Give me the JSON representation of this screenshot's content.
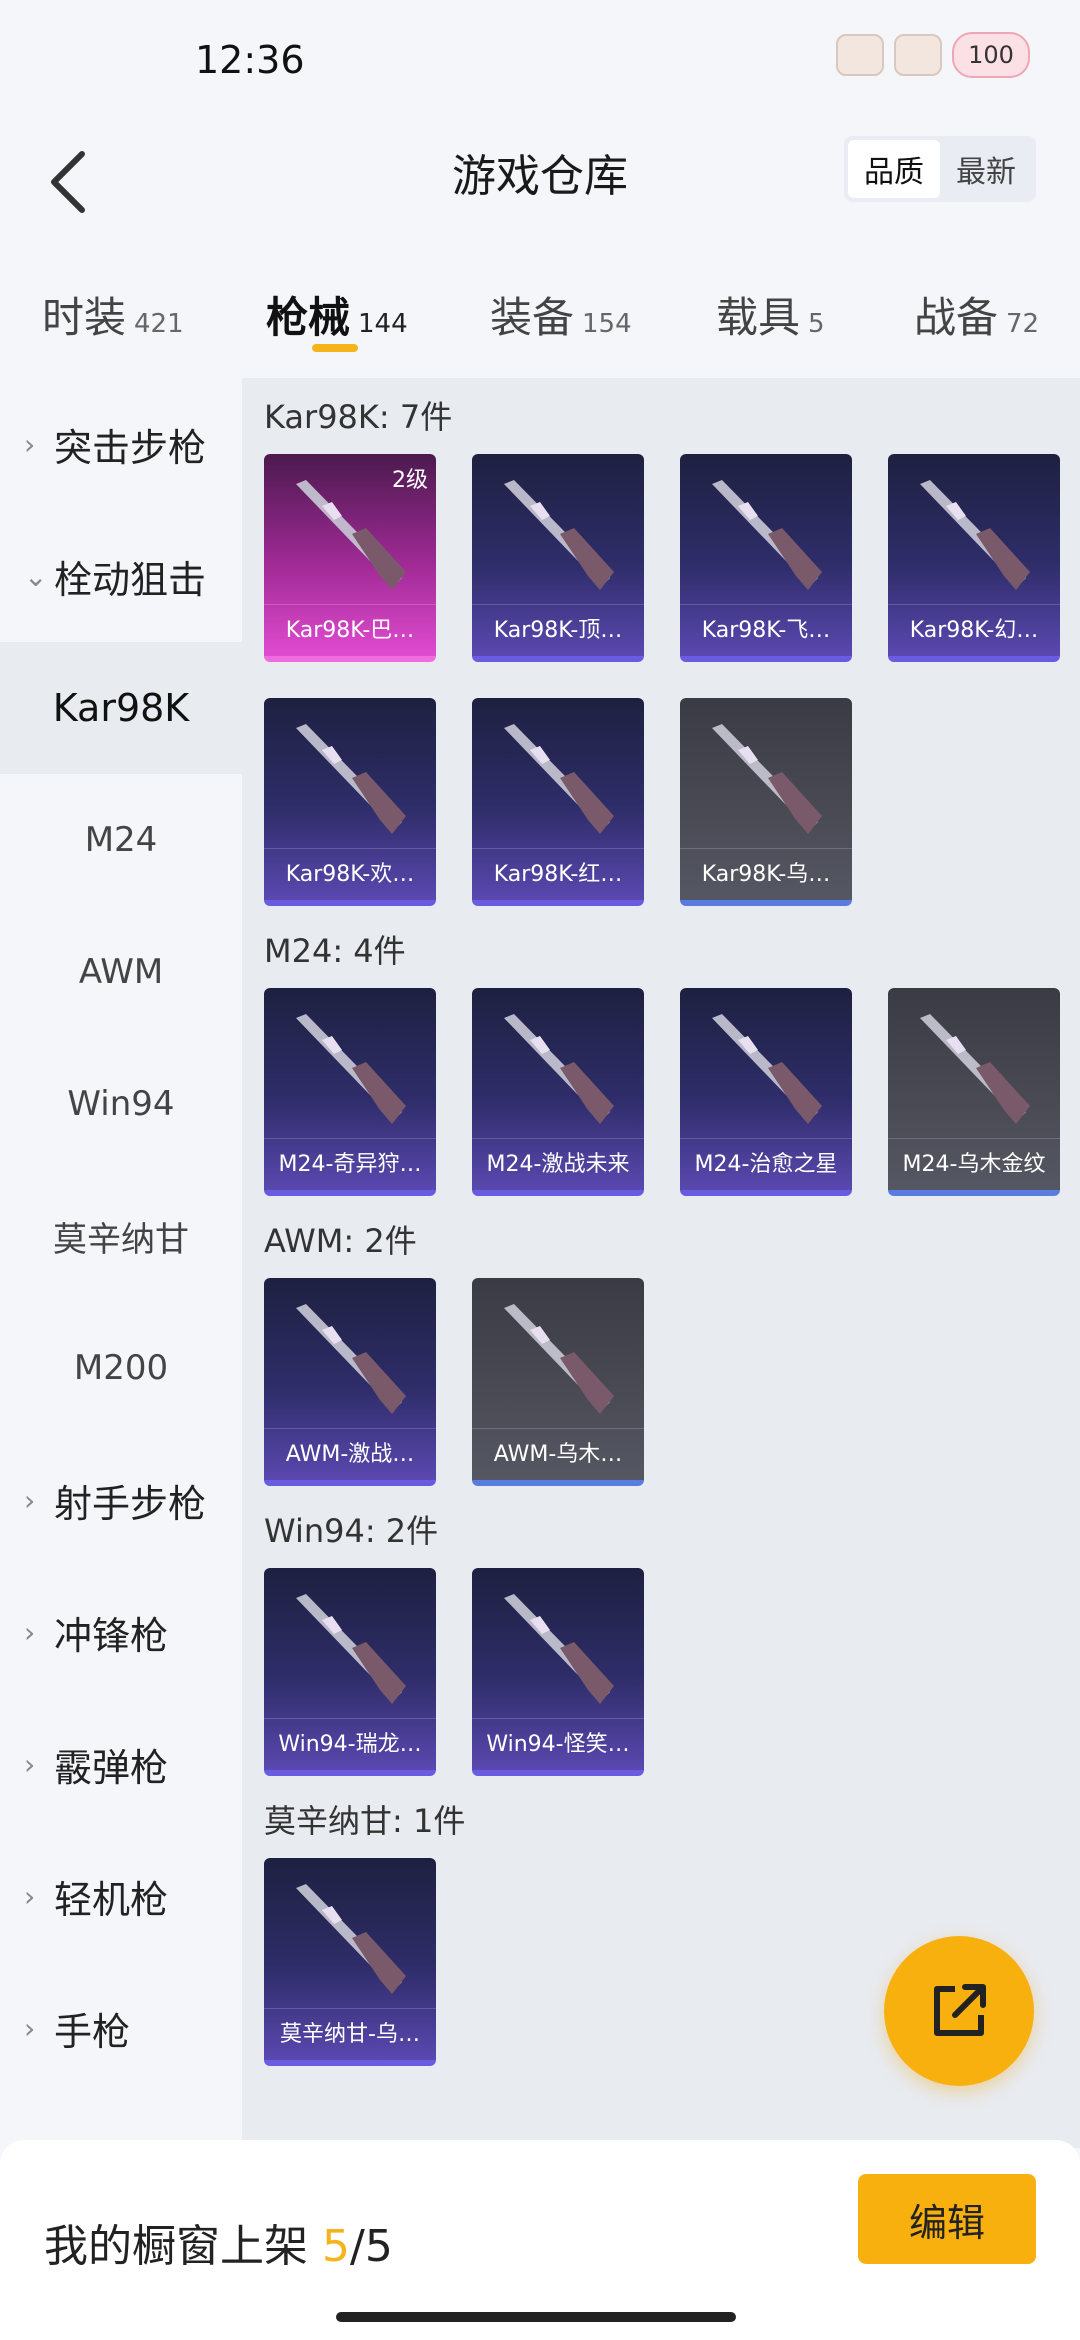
{
  "status_bar": {
    "time": "12:36",
    "battery": "100"
  },
  "header": {
    "title": "游戏仓库",
    "sort_options": [
      "品质",
      "最新"
    ],
    "sort_active": "品质"
  },
  "tabs": [
    {
      "label": "时装",
      "count": "421"
    },
    {
      "label": "枪械",
      "count": "144"
    },
    {
      "label": "装备",
      "count": "154"
    },
    {
      "label": "载具",
      "count": "5"
    },
    {
      "label": "战备",
      "count": "72"
    }
  ],
  "sidebar": {
    "categories": [
      "突击步枪",
      "栓动狙击",
      "射手步枪",
      "冲锋枪",
      "霰弹枪",
      "轻机枪",
      "手枪"
    ],
    "subitems": [
      "Kar98K",
      "M24",
      "AWM",
      "Win94",
      "莫辛纳甘",
      "M200"
    ],
    "selected": "Kar98K"
  },
  "groups": [
    {
      "title": "Kar98K: 7件",
      "items": [
        {
          "label": "Kar98K-巴…",
          "rarity": "pink",
          "level": "2级"
        },
        {
          "label": "Kar98K-顶…",
          "rarity": "purple"
        },
        {
          "label": "Kar98K-飞…",
          "rarity": "purple"
        },
        {
          "label": "Kar98K-幻…",
          "rarity": "purple"
        },
        {
          "label": "Kar98K-欢…",
          "rarity": "purple"
        },
        {
          "label": "Kar98K-红…",
          "rarity": "purple"
        },
        {
          "label": "Kar98K-乌…",
          "rarity": "gray"
        }
      ]
    },
    {
      "title": "M24: 4件",
      "items": [
        {
          "label": "M24-奇异狩…",
          "rarity": "purple"
        },
        {
          "label": "M24-激战未来",
          "rarity": "purple"
        },
        {
          "label": "M24-治愈之星",
          "rarity": "purple"
        },
        {
          "label": "M24-乌木金纹",
          "rarity": "gray"
        }
      ]
    },
    {
      "title": "AWM: 2件",
      "items": [
        {
          "label": "AWM-激战…",
          "rarity": "purple"
        },
        {
          "label": "AWM-乌木…",
          "rarity": "gray"
        }
      ]
    },
    {
      "title": "Win94: 2件",
      "items": [
        {
          "label": "Win94-瑞龙…",
          "rarity": "purple"
        },
        {
          "label": "Win94-怪笑…",
          "rarity": "purple"
        }
      ]
    },
    {
      "title": "莫辛纳甘: 1件",
      "items": [
        {
          "label": "莫辛纳甘-乌…",
          "rarity": "purple"
        }
      ]
    }
  ],
  "bottom_bar": {
    "showcase_label": "我的橱窗上架 ",
    "showcase_current": "5",
    "showcase_sep": "/",
    "showcase_total": "5",
    "edit_label": "编辑"
  },
  "colors": {
    "accent": "#f8b00e",
    "pink_rarity": "#e04bd0",
    "purple_rarity": "#5a48b0",
    "gray_rarity": "#4a4b55"
  }
}
